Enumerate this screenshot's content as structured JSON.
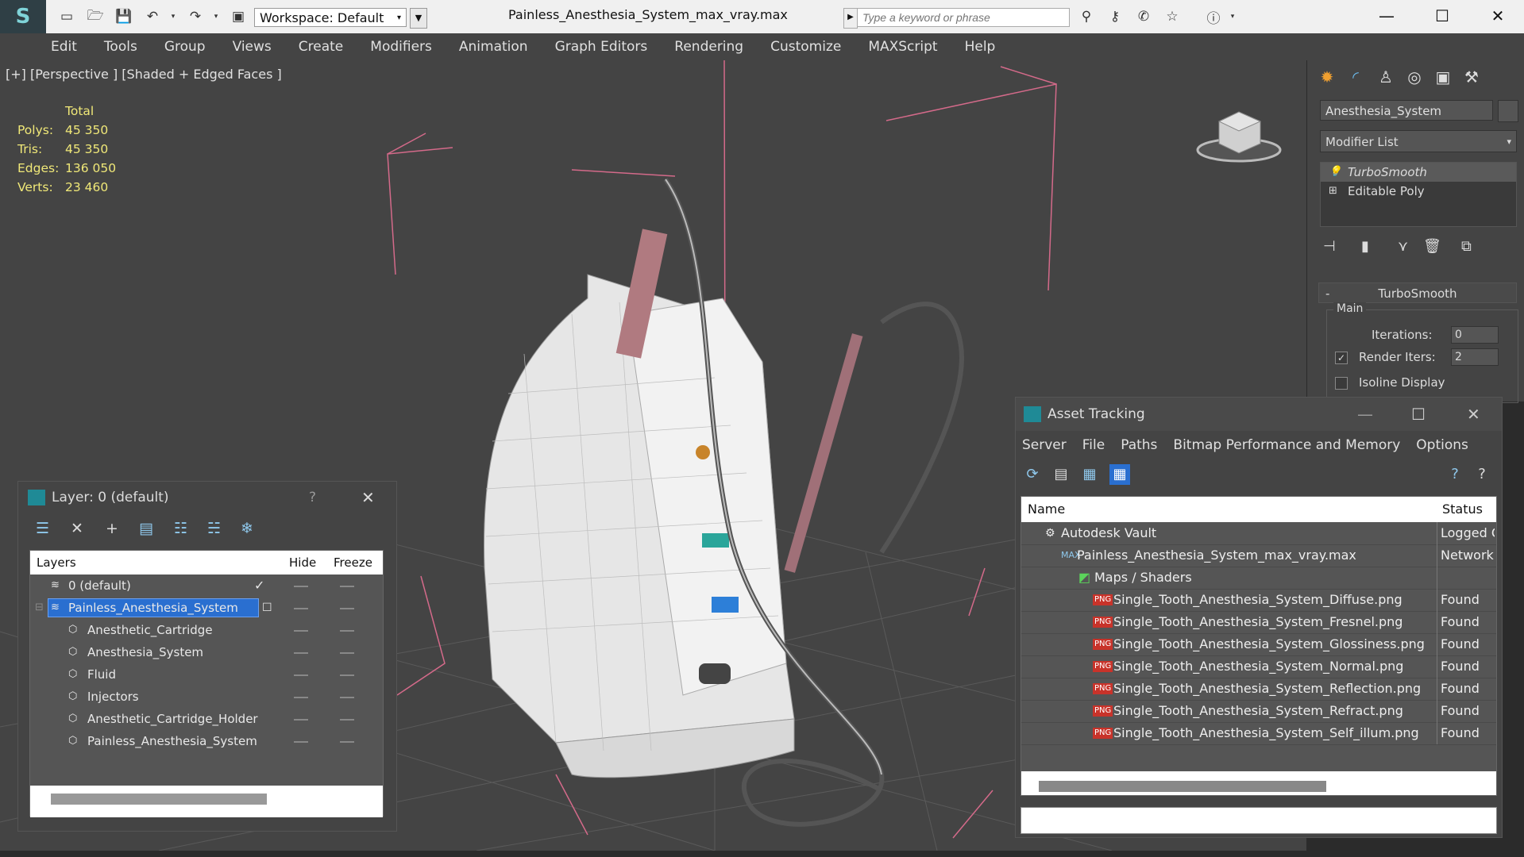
{
  "titlebar": {
    "workspace_label": "Workspace: Default",
    "file_title": "Painless_Anesthesia_System_max_vray.max",
    "search_placeholder": "Type a keyword or phrase"
  },
  "menubar": [
    "Edit",
    "Tools",
    "Group",
    "Views",
    "Create",
    "Modifiers",
    "Animation",
    "Graph Editors",
    "Rendering",
    "Customize",
    "MAXScript",
    "Help"
  ],
  "viewport": {
    "label": "[+] [Perspective ] [Shaded + Edged Faces ]",
    "stats": {
      "header": "Total",
      "rows": [
        {
          "label": "Polys:",
          "value": "45 350"
        },
        {
          "label": "Tris:",
          "value": "45 350"
        },
        {
          "label": "Edges:",
          "value": "136 050"
        },
        {
          "label": "Verts:",
          "value": "23 460"
        }
      ]
    }
  },
  "command_panel": {
    "object_name": "Anesthesia_System",
    "modifier_list": "Modifier List",
    "stack": [
      "TurboSmooth",
      "Editable Poly"
    ],
    "rollout_title": "TurboSmooth",
    "group_main": "Main",
    "iterations_label": "Iterations:",
    "iterations_value": "0",
    "render_iters_label": "Render Iters:",
    "render_iters_value": "2",
    "isoline_label": "Isoline Display"
  },
  "layer_dialog": {
    "title": "Layer: 0 (default)",
    "help": "?",
    "columns": [
      "Layers",
      "Hide",
      "Freeze"
    ],
    "rows": [
      {
        "name": "0 (default)",
        "level": 0
      },
      {
        "name": "Painless_Anesthesia_System",
        "level": 0
      },
      {
        "name": "Anesthetic_Cartridge",
        "level": 1
      },
      {
        "name": "Anesthesia_System",
        "level": 1
      },
      {
        "name": "Fluid",
        "level": 1
      },
      {
        "name": "Injectors",
        "level": 1
      },
      {
        "name": "Anesthetic_Cartridge_Holder",
        "level": 1
      },
      {
        "name": "Painless_Anesthesia_System",
        "level": 1
      }
    ]
  },
  "asset_dialog": {
    "title": "Asset Tracking",
    "menu": [
      "Server",
      "File",
      "Paths",
      "Bitmap Performance and Memory",
      "Options"
    ],
    "columns": [
      "Name",
      "Status"
    ],
    "rows": [
      {
        "name": "Autodesk Vault",
        "status": "Logged O",
        "level": 0
      },
      {
        "name": "Painless_Anesthesia_System_max_vray.max",
        "status": "Network",
        "level": 1
      },
      {
        "name": "Maps / Shaders",
        "status": "",
        "level": 2
      },
      {
        "name": "Single_Tooth_Anesthesia_System_Diffuse.png",
        "status": "Found",
        "level": 3
      },
      {
        "name": "Single_Tooth_Anesthesia_System_Fresnel.png",
        "status": "Found",
        "level": 3
      },
      {
        "name": "Single_Tooth_Anesthesia_System_Glossiness.png",
        "status": "Found",
        "level": 3
      },
      {
        "name": "Single_Tooth_Anesthesia_System_Normal.png",
        "status": "Found",
        "level": 3
      },
      {
        "name": "Single_Tooth_Anesthesia_System_Reflection.png",
        "status": "Found",
        "level": 3
      },
      {
        "name": "Single_Tooth_Anesthesia_System_Refract.png",
        "status": "Found",
        "level": 3
      },
      {
        "name": "Single_Tooth_Anesthesia_System_Self_illum.png",
        "status": "Found",
        "level": 3
      }
    ]
  },
  "colors": {
    "viewport_bg": "#444444",
    "stats_text": "#f0e878",
    "layer_selected": "#2a6fd0",
    "icon_blue": "#8fc8ec"
  }
}
